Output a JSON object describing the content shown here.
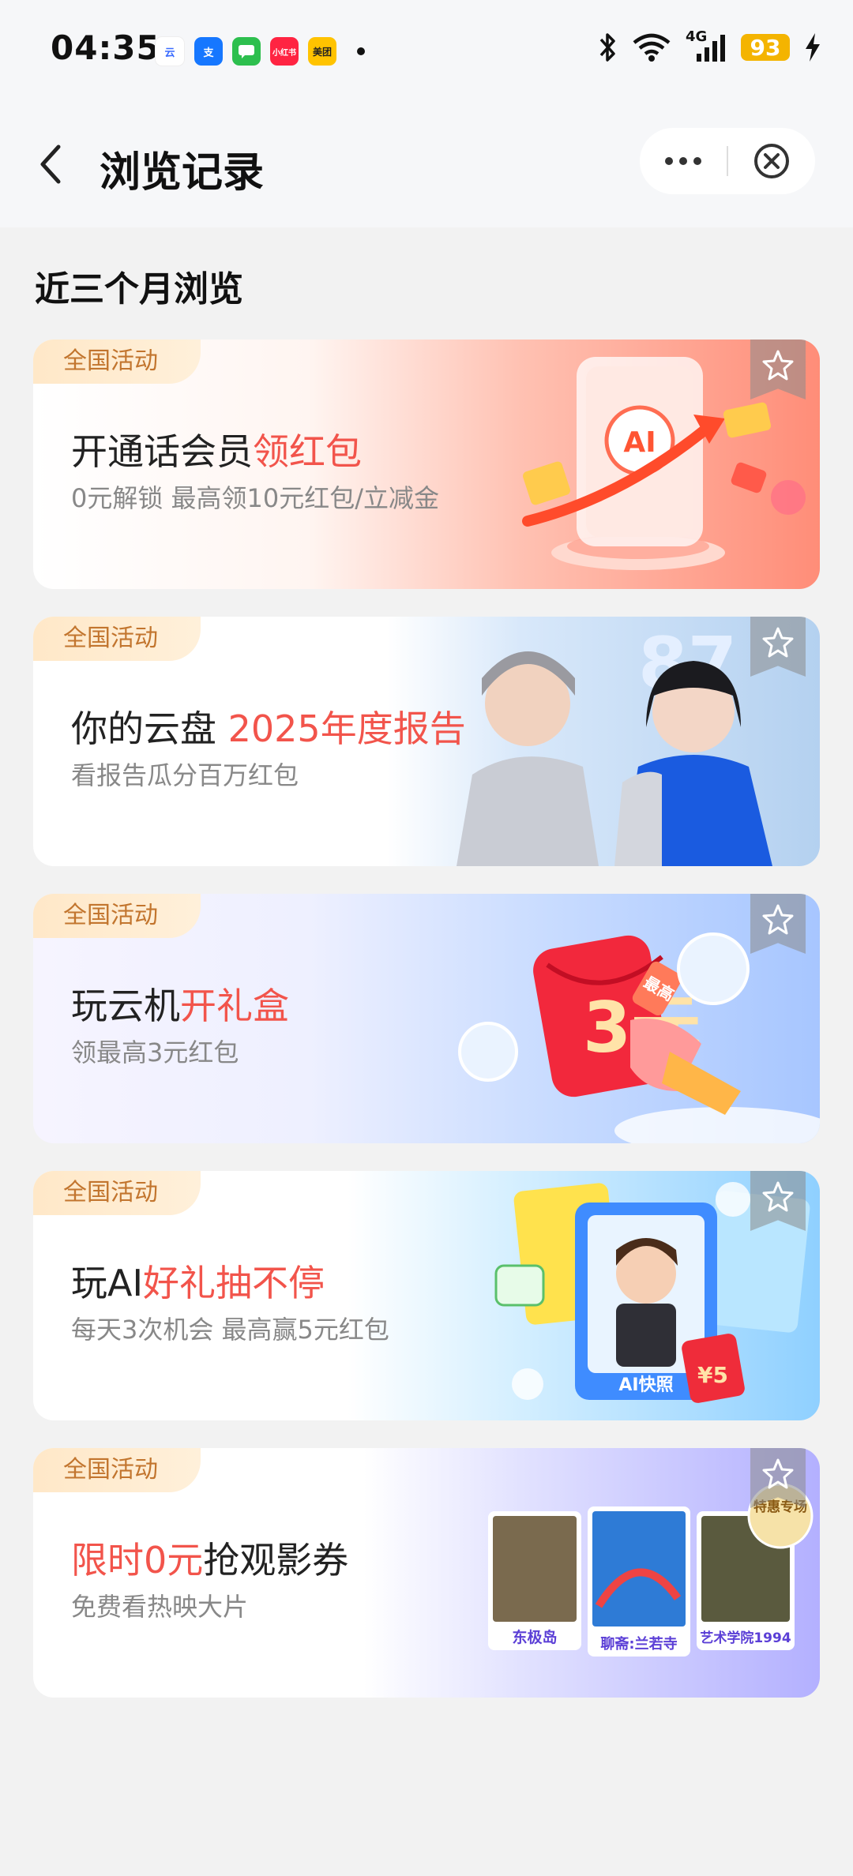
{
  "status_bar": {
    "time": "04:35",
    "app_icons": [
      {
        "name": "cloud-app-icon",
        "color": "#ffffff",
        "text": "云"
      },
      {
        "name": "alipay-icon",
        "color": "#1677ff",
        "text": "支"
      },
      {
        "name": "message-icon",
        "color": "#2dbf4e",
        "text": ""
      },
      {
        "name": "xiaohongshu-icon",
        "color": "#ff2442",
        "text": "小红书"
      },
      {
        "name": "meituan-icon",
        "color": "#ffc300",
        "text": "美团"
      }
    ],
    "network": "4G",
    "battery": "93"
  },
  "nav": {
    "title": "浏览记录"
  },
  "section": {
    "title": "近三个月浏览"
  },
  "cards": [
    {
      "tag": "全国活动",
      "title_plain": "开通话会员",
      "title_highlight": "领红包",
      "title_plain_after": "",
      "subtitle": "0元解锁 最高领10元红包/立减金",
      "bg_from": "#ffffff",
      "bg_to": "#ff9d8a"
    },
    {
      "tag": "全国活动",
      "title_plain": "你的云盘 ",
      "title_highlight": "2025年度报告",
      "title_plain_after": "",
      "subtitle": "看报告瓜分百万红包",
      "bg_from": "#ffffff",
      "bg_to": "#b8d6f5"
    },
    {
      "tag": "全国活动",
      "title_plain": "玩云机",
      "title_highlight": "开礼盒",
      "title_plain_after": "",
      "subtitle": "领最高3元红包",
      "bg_from": "#f3f3ff",
      "bg_to": "#a9c8ff"
    },
    {
      "tag": "全国活动",
      "title_plain": "玩AI",
      "title_highlight": "好礼抽不停",
      "title_plain_after": "",
      "subtitle": "每天3次机会 最高赢5元红包",
      "bg_from": "#ffffff",
      "bg_to": "#8fd3ff"
    },
    {
      "tag": "全国活动",
      "title_plain": "",
      "title_highlight": "限时0元",
      "title_plain_after": "抢观影券",
      "subtitle": "免费看热映大片",
      "bg_from": "#ffffff",
      "bg_to": "#b7b4ff"
    }
  ],
  "card_art": {
    "card1": {
      "badge": "AI"
    },
    "card3": {
      "amount": "3元",
      "tag": "最高"
    },
    "card4": {
      "badge": "AI快照",
      "amount": "¥5"
    },
    "card5": {
      "posters": [
        "东极岛",
        "聊斋:兰若寺",
        "艺术学院1994"
      ],
      "badge": "特惠专场"
    }
  }
}
